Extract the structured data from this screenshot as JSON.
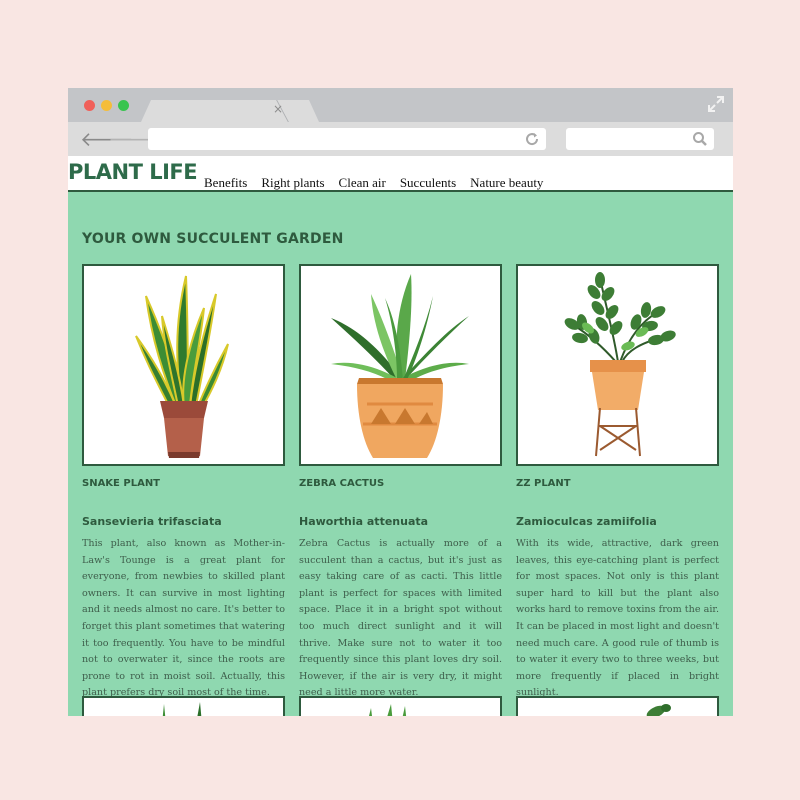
{
  "site": {
    "logo": "PLANT LIFE",
    "nav": [
      "Benefits",
      "Right plants",
      "Clean air",
      "Succulents",
      "Nature beauty"
    ]
  },
  "section": {
    "title": "YOUR OWN SUCCULENT GARDEN"
  },
  "plants": [
    {
      "name": "SNAKE PLANT",
      "latin": "Sansevieria trifasciata",
      "description": "This plant, also known as Mother-in-Law's Tounge is a great plant for everyone, from newbies to skilled plant owners. It can survive in most lighting and it needs almost no care. It's better to forget this plant sometimes that watering it too frequently. You have to be mindful not to overwater it, since the roots are prone to rot in moist soil. Actually, this plant prefers dry soil most of the time."
    },
    {
      "name": "ZEBRA CACTUS",
      "latin": "Haworthia attenuata",
      "description": "Zebra Cactus is actually more of a succulent than a cactus, but it's just as easy taking care of as cacti. This little plant is perfect for spaces with limited space. Place it in a bright spot without too much direct sunlight and it will thrive. Make sure not to water it too frequently since this plant loves dry soil. However, if the air is very dry, it might need a little more water."
    },
    {
      "name": "ZZ PLANT",
      "latin": "Zamioculcas zamiifolia",
      "description": "With its wide, attractive, dark green leaves, this eye-catching plant is perfect for most spaces. Not only is this plant super hard to kill but the plant also works hard to remove toxins from the air. It can be placed in most light and doesn't need much care. A good rule of thumb is to water it every two to three weeks, but more frequently if placed in bright sunlight."
    }
  ],
  "colors": {
    "page_background": "#f9e6e3",
    "content_background": "#8fd8b0",
    "heading_green": "#2e5a3e",
    "logo_green": "#2e6b4a"
  }
}
